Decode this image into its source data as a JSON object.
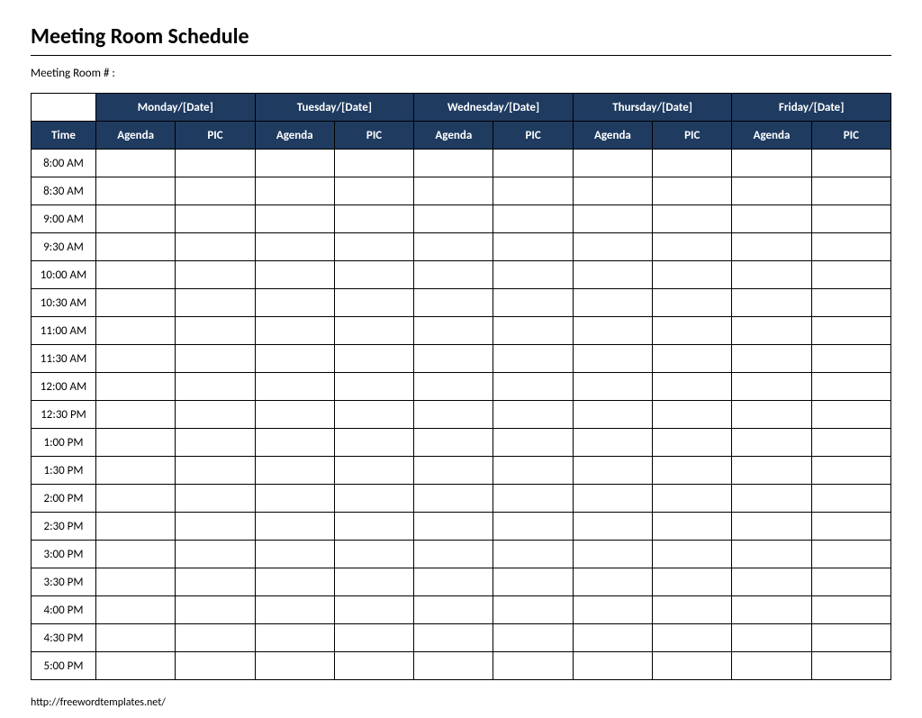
{
  "title": "Meeting Room Schedule",
  "room_label": "Meeting Room # :",
  "header": {
    "time_label": "Time",
    "days": [
      "Monday/[Date]",
      "Tuesday/[Date]",
      "Wednesday/[Date]",
      "Thursday/[Date]",
      "Friday/[Date]"
    ],
    "sub_agenda": "Agenda",
    "sub_pic": "PIC"
  },
  "times": [
    "8:00 AM",
    "8:30 AM",
    "9:00 AM",
    "9:30 AM",
    "10:00 AM",
    "10:30 AM",
    "11:00 AM",
    "11:30 AM",
    "12:00 AM",
    "12:30 PM",
    "1:00 PM",
    "1:30 PM",
    "2:00 PM",
    "2:30 PM",
    "3:00 PM",
    "3:30 PM",
    "4:00 PM",
    "4:30 PM",
    "5:00 PM"
  ],
  "footer_url": "http://freewordtemplates.net/"
}
